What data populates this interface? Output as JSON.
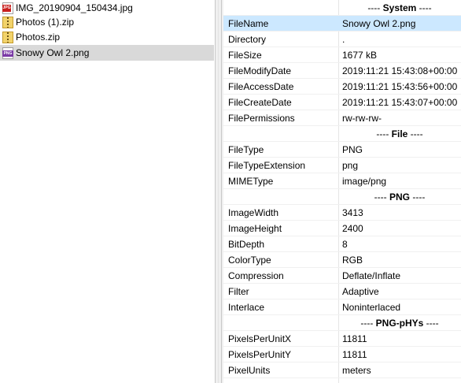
{
  "files": [
    {
      "name": "IMG_20190904_150434.jpg",
      "icon": "jpg-file-icon",
      "icon_label": "JPG",
      "selected": false
    },
    {
      "name": "Photos (1).zip",
      "icon": "zip-file-icon",
      "selected": false
    },
    {
      "name": "Photos.zip",
      "icon": "zip-file-icon",
      "selected": false
    },
    {
      "name": "Snowy Owl 2.png",
      "icon": "png-file-icon",
      "icon_label": "PNG",
      "selected": true
    }
  ],
  "metadata": [
    {
      "type": "header",
      "label": "System"
    },
    {
      "key": "FileName",
      "value": "Snowy Owl 2.png",
      "selected": true
    },
    {
      "key": "Directory",
      "value": "."
    },
    {
      "key": "FileSize",
      "value": "1677 kB"
    },
    {
      "key": "FileModifyDate",
      "value": "2019:11:21 15:43:08+00:00"
    },
    {
      "key": "FileAccessDate",
      "value": "2019:11:21 15:43:56+00:00"
    },
    {
      "key": "FileCreateDate",
      "value": "2019:11:21 15:43:07+00:00"
    },
    {
      "key": "FilePermissions",
      "value": "rw-rw-rw-"
    },
    {
      "type": "header",
      "label": "File"
    },
    {
      "key": "FileType",
      "value": "PNG"
    },
    {
      "key": "FileTypeExtension",
      "value": "png"
    },
    {
      "key": "MIMEType",
      "value": "image/png"
    },
    {
      "type": "header",
      "label": "PNG"
    },
    {
      "key": "ImageWidth",
      "value": "3413"
    },
    {
      "key": "ImageHeight",
      "value": "2400"
    },
    {
      "key": "BitDepth",
      "value": "8"
    },
    {
      "key": "ColorType",
      "value": "RGB"
    },
    {
      "key": "Compression",
      "value": "Deflate/Inflate"
    },
    {
      "key": "Filter",
      "value": "Adaptive"
    },
    {
      "key": "Interlace",
      "value": "Noninterlaced"
    },
    {
      "type": "header",
      "label": "PNG-pHYs"
    },
    {
      "key": "PixelsPerUnitX",
      "value": "11811"
    },
    {
      "key": "PixelsPerUnitY",
      "value": "11811"
    },
    {
      "key": "PixelUnits",
      "value": "meters"
    }
  ],
  "colors": {
    "selected_row": "#cce8ff",
    "selected_file": "#d9d9d9",
    "jpg_badge": "#c8201e",
    "png_badge": "#7b3aa6"
  }
}
